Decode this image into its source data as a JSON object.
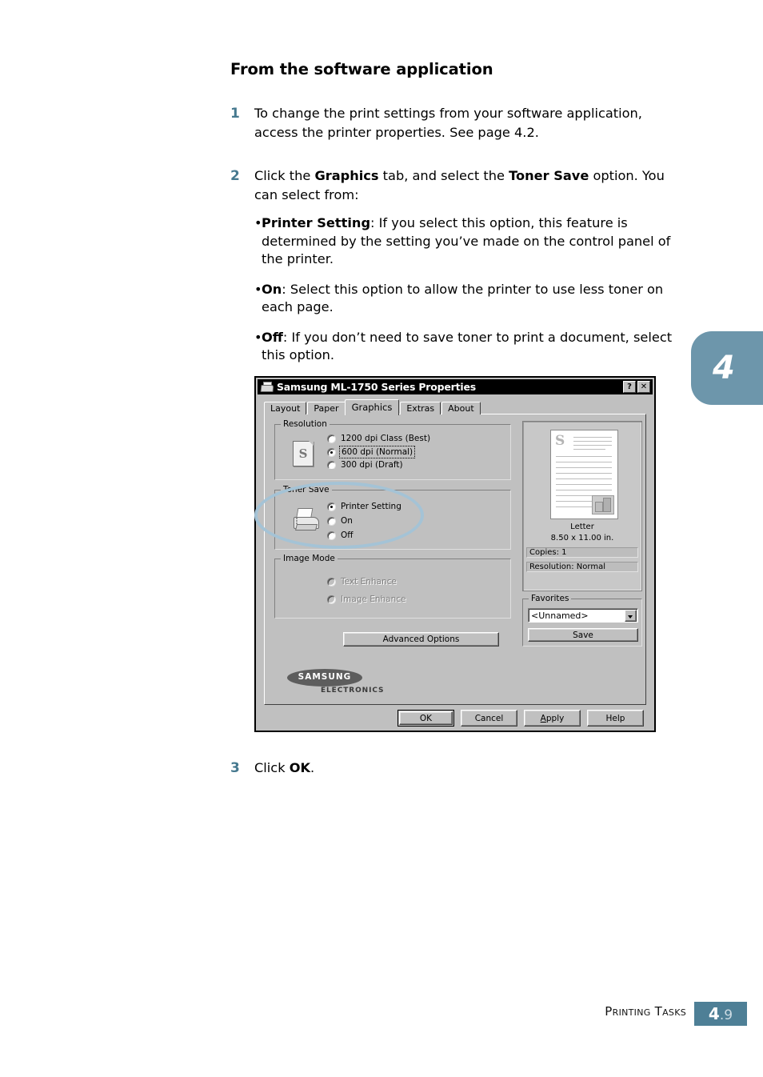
{
  "page": {
    "heading": "From the software application",
    "steps": [
      {
        "num": "1",
        "text": "To change the print settings from your software application, access the printer properties. See page 4.2."
      },
      {
        "num": "2",
        "text_before": "Click the ",
        "bold1": "Graphics",
        "text_mid": " tab, and select the ",
        "bold2": "Toner Save",
        "text_after": " option. You can select from:"
      },
      {
        "num": "3",
        "text_before": "Click ",
        "bold1": "OK",
        "text_after": "."
      }
    ],
    "bullets": [
      {
        "marker": "•",
        "label": "Printer Setting",
        "text": ": If you select this option, this feature is determined by the setting you’ve made on the control panel of the printer."
      },
      {
        "marker": "•",
        "label": "On",
        "text": ": Select this option to allow the printer to use less toner on each page."
      },
      {
        "marker": "•",
        "label": "Off",
        "text": ": If you don’t need to save toner to print a document, select this option."
      }
    ],
    "chapter_tab": {
      "number": "4",
      "color": "#6d96ab"
    },
    "footer": {
      "label": "Printing Tasks",
      "page_major": "4",
      "page_minor": ".9",
      "box_color": "#4e7f96"
    }
  },
  "dialog": {
    "title": "Samsung ML-1750 Series Properties",
    "titlebar_buttons": [
      {
        "name": "help",
        "glyph": "?"
      },
      {
        "name": "close",
        "glyph": "✕"
      }
    ],
    "tabs": [
      {
        "label": "Layout",
        "active": false
      },
      {
        "label": "Paper",
        "active": false
      },
      {
        "label": "Graphics",
        "active": true
      },
      {
        "label": "Extras",
        "active": false
      },
      {
        "label": "About",
        "active": false
      }
    ],
    "groups": {
      "resolution": {
        "title": "Resolution",
        "options": [
          {
            "label": "1200 dpi Class (Best)",
            "checked": false,
            "disabled": false,
            "focused": false
          },
          {
            "label": "600 dpi (Normal)",
            "checked": true,
            "disabled": false,
            "focused": true
          },
          {
            "label": "300 dpi (Draft)",
            "checked": false,
            "disabled": false,
            "focused": false
          }
        ]
      },
      "toner_save": {
        "title": "Toner Save",
        "options": [
          {
            "label": "Printer Setting",
            "checked": true,
            "disabled": false,
            "focused": false
          },
          {
            "label": "On",
            "checked": false,
            "disabled": false,
            "focused": false
          },
          {
            "label": "Off",
            "checked": false,
            "disabled": false,
            "focused": false
          }
        ]
      },
      "image_mode": {
        "title": "Image Mode",
        "options": [
          {
            "label": "Text Enhance",
            "checked": false,
            "disabled": true,
            "focused": false
          },
          {
            "label": "Image Enhance",
            "checked": false,
            "disabled": true,
            "focused": false
          }
        ]
      },
      "favorites": {
        "title": "Favorites",
        "selected": "<Unnamed>",
        "save_label": "Save"
      }
    },
    "advanced_options_label": "Advanced Options",
    "preview": {
      "page_letter": "S",
      "paper_name": "Letter",
      "paper_size": "8.50 x 11.00 in.",
      "copies": "Copies: 1",
      "resolution": "Resolution: Normal"
    },
    "brand": {
      "name": "SAMSUNG",
      "sub": "ELECTRONICS"
    },
    "buttons": [
      {
        "label": "OK",
        "default": true
      },
      {
        "label": "Cancel",
        "default": false
      },
      {
        "label": "Apply",
        "default": false,
        "accel": "A"
      },
      {
        "label": "Help",
        "default": false
      }
    ]
  },
  "annotation": {
    "shape": "ellipse",
    "color": "#a4c3d6",
    "target": "Toner Save"
  }
}
